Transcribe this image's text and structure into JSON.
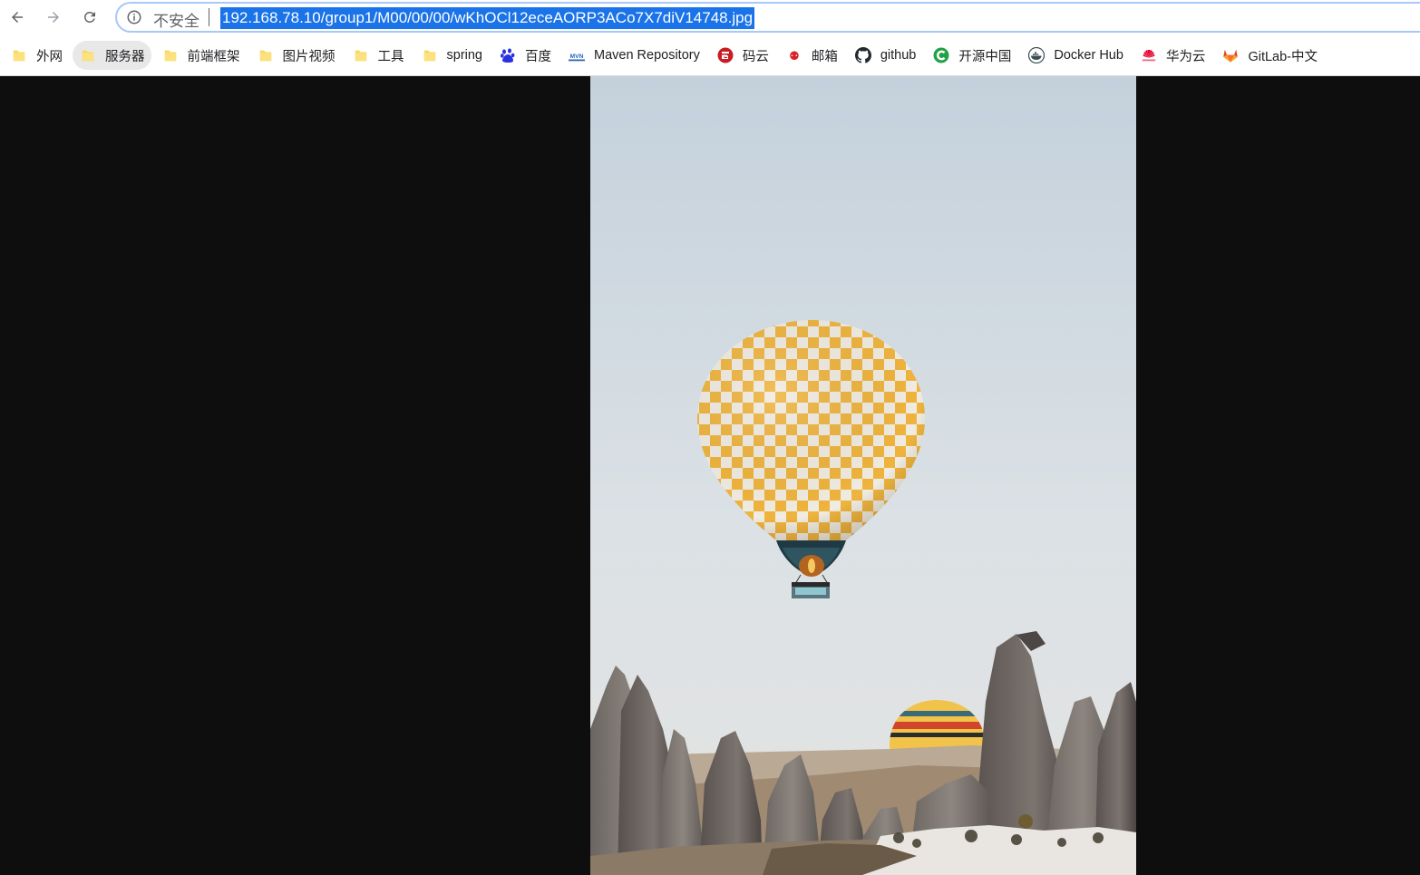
{
  "nav": {
    "back_label": "Back",
    "forward_label": "Forward",
    "reload_label": "Reload"
  },
  "omnibox": {
    "security": "不安全",
    "url": "192.168.78.10/group1/M00/00/00/wKhOCl12eceAORP3ACo7X7diV14748.jpg"
  },
  "bookmarks": [
    {
      "label": "外网",
      "icon": "folder-icon"
    },
    {
      "label": "服务器",
      "icon": "folder-icon",
      "active": true
    },
    {
      "label": "前端框架",
      "icon": "folder-icon"
    },
    {
      "label": "图片视频",
      "icon": "folder-icon"
    },
    {
      "label": "工具",
      "icon": "folder-icon"
    },
    {
      "label": "spring",
      "icon": "folder-icon"
    },
    {
      "label": "百度",
      "icon": "baidu-icon"
    },
    {
      "label": "Maven Repository",
      "icon": "maven-icon"
    },
    {
      "label": "码云",
      "icon": "gitee-icon"
    },
    {
      "label": "邮箱",
      "icon": "mail-163-icon"
    },
    {
      "label": "github",
      "icon": "github-icon"
    },
    {
      "label": "开源中国",
      "icon": "oschina-icon"
    },
    {
      "label": "Docker Hub",
      "icon": "docker-icon"
    },
    {
      "label": "华为云",
      "icon": "huawei-icon"
    },
    {
      "label": "GitLab-中文",
      "icon": "gitlab-icon"
    }
  ],
  "colors": {
    "url_highlight": "#1a73e8",
    "viewport_bg": "#0e0e0e",
    "folder": "#f9d85b"
  },
  "image": {
    "subject": "hot-air-balloon-photo"
  }
}
